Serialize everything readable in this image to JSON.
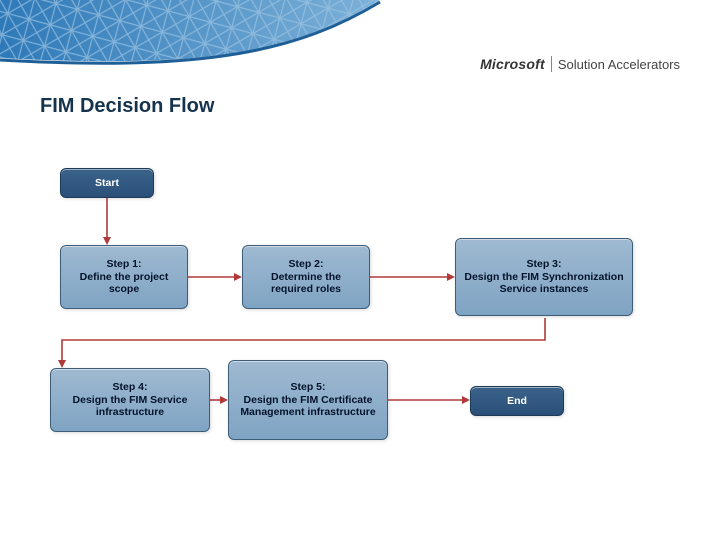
{
  "brand": {
    "left": "Microsoft",
    "right": "Solution Accelerators"
  },
  "title": "FIM Decision Flow",
  "nodes": {
    "start": {
      "label": "Start"
    },
    "s1": {
      "title": "Step 1:",
      "body": "Define the project scope"
    },
    "s2": {
      "title": "Step 2:",
      "body": "Determine the required roles"
    },
    "s3": {
      "title": "Step 3:",
      "body": "Design the FIM Synchronization Service instances"
    },
    "s4": {
      "title": "Step 4:",
      "body": "Design the FIM Service infrastructure"
    },
    "s5": {
      "title": "Step 5:",
      "body": "Design the FIM Certificate Management infrastructure"
    },
    "end": {
      "label": "End"
    }
  },
  "colors": {
    "arrow": "#b03a3a",
    "nodeLight": "#8eafcb",
    "nodeDark": "#2f567e"
  }
}
